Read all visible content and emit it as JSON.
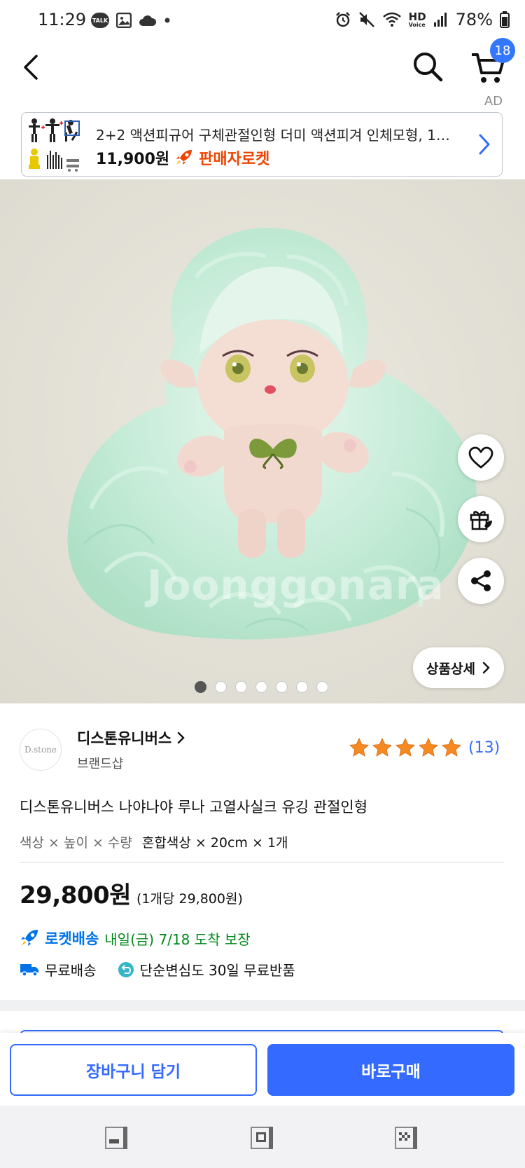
{
  "status_bar": {
    "time": "11:29",
    "talk_badge": "TALK",
    "hd_label": "HD",
    "voice_label": "Voice",
    "battery": "78%"
  },
  "header": {
    "cart_count": "18",
    "ad_label": "AD"
  },
  "ad_banner": {
    "title": "2+2 액션피규어 구체관절인형 더미 액션피겨 인체모형, 1세...",
    "price": "11,900원",
    "rocket_label": "판매자로켓"
  },
  "product_image": {
    "watermark": "Joonggonara",
    "detail_button_label": "상품상세",
    "dots_count": 7,
    "active_dot": 0
  },
  "seller": {
    "logo_text": "D.stone",
    "name": "디스톤유니버스",
    "type": "브랜드샵",
    "rating_stars": 5,
    "review_count": "(13)"
  },
  "product": {
    "title": "디스톤유니버스 나야나야 루나 고열사실크 유깅 관절인형",
    "option_label": "색상 × 높이 × 수량",
    "option_value": "혼합색상 × 20cm × 1개",
    "price": "29,800원",
    "unit_price": "(1개당 29,800원)"
  },
  "delivery": {
    "rocket_label": "로켓배송",
    "eta": "내일(금) 7/18 도착 보장",
    "free_shipping": "무료배송",
    "free_return": "단순변심도 30일 무료반품"
  },
  "actions": {
    "add_to_cart": "장바구니 담기",
    "buy_now": "바로구매"
  },
  "colors": {
    "accent": "#346aff",
    "rocket_blue": "#0073e9",
    "eta_green": "#00891a",
    "star_orange": "#f58a23",
    "ad_rocket_red": "#ee4400"
  }
}
